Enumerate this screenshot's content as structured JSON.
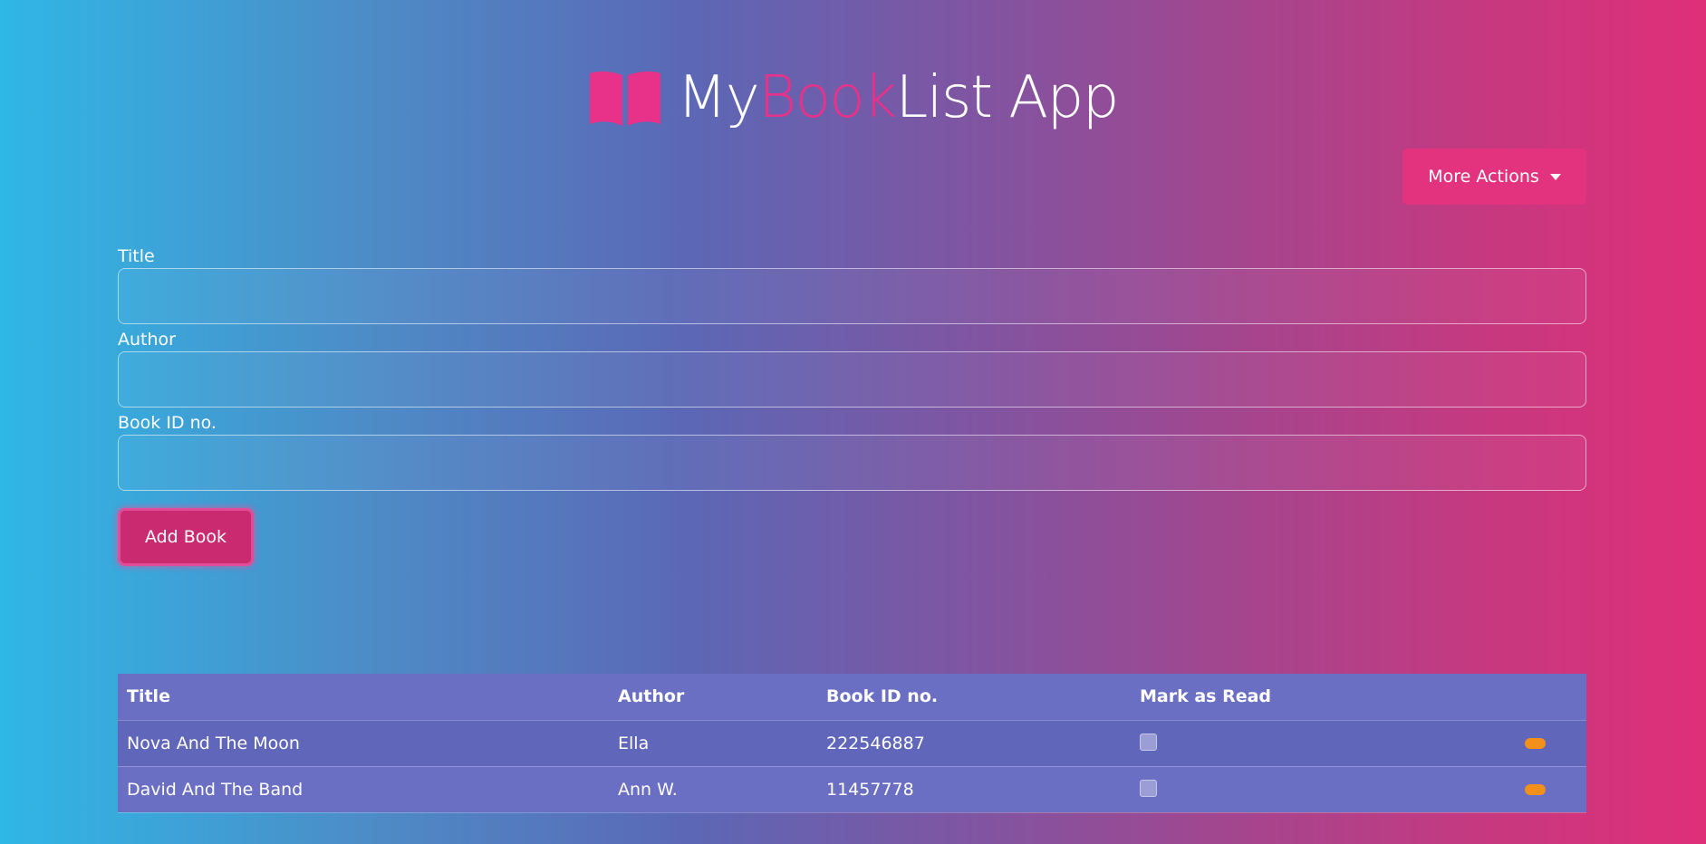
{
  "header": {
    "title_part1": "My",
    "title_part2": "Book",
    "title_part3": "List App",
    "logo_icon": "book-open-icon"
  },
  "actions": {
    "more_actions_label": "More Actions",
    "more_actions_icon": "caret-down-icon"
  },
  "form": {
    "title_label": "Title",
    "title_value": "",
    "author_label": "Author",
    "author_value": "",
    "book_id_label": "Book ID no.",
    "book_id_value": "",
    "submit_label": "Add Book"
  },
  "table": {
    "columns": [
      "Title",
      "Author",
      "Book ID no.",
      "Mark as Read",
      ""
    ],
    "rows": [
      {
        "title": "Nova And The Moon",
        "author": "Ella",
        "book_id": "222546887",
        "read": false
      },
      {
        "title": "David And The Band",
        "author": "Ann W.",
        "book_id": "11457778",
        "read": false
      }
    ]
  },
  "colors": {
    "accent_pink": "#e3337e",
    "gradient_start": "#2fb7e5",
    "gradient_end": "#df2f79",
    "delete_button": "#f39019"
  }
}
